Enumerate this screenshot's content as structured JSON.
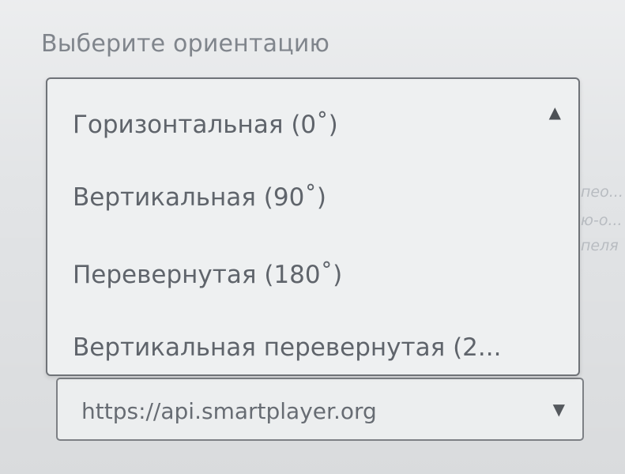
{
  "label": "Выберите ориентацию",
  "orientation_dropdown": {
    "options": [
      "Горизонтальная (0˚)",
      "Вертикальная (90˚)",
      "Перевернутая (180˚)",
      "Вертикальная перевернутая (2..."
    ],
    "caret": "▲"
  },
  "url_select": {
    "value": "https://api.smartplayer.org",
    "caret": "▼"
  },
  "background_text": [
    "пео...",
    "ю-о...",
    "пеля"
  ]
}
